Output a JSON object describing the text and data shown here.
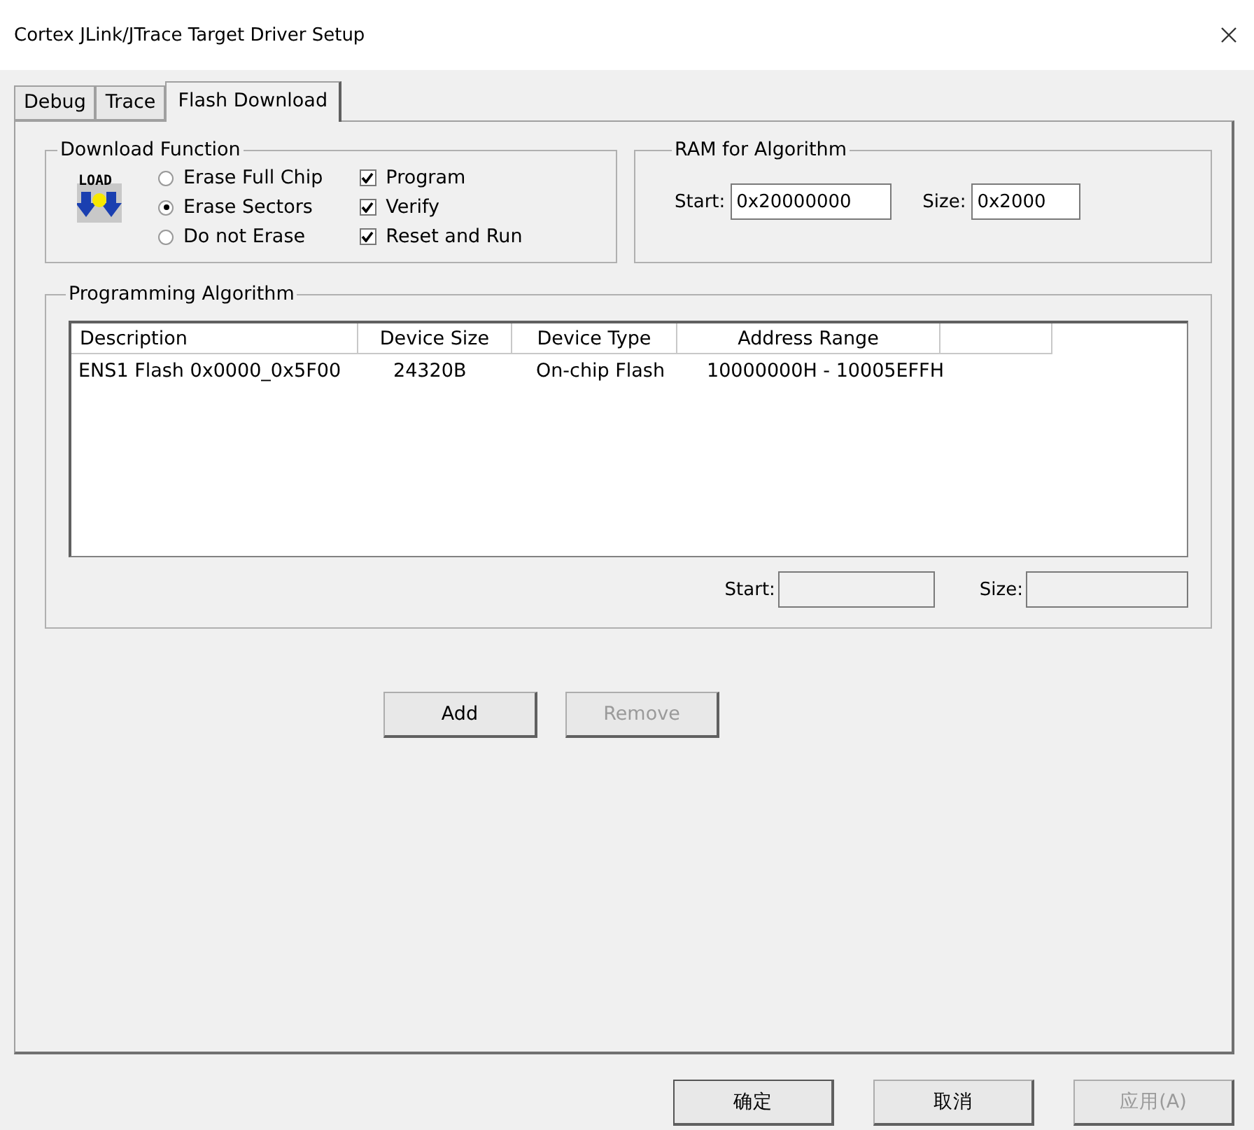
{
  "window": {
    "title": "Cortex JLink/JTrace Target Driver Setup"
  },
  "tabs": [
    {
      "label": "Debug",
      "selected": false
    },
    {
      "label": "Trace",
      "selected": false
    },
    {
      "label": "Flash Download",
      "selected": true
    }
  ],
  "download_function": {
    "title": "Download Function",
    "icon_label": "LOAD",
    "erase_options": [
      {
        "label": "Erase Full Chip",
        "selected": false
      },
      {
        "label": "Erase Sectors",
        "selected": true
      },
      {
        "label": "Do not Erase",
        "selected": false
      }
    ],
    "actions": [
      {
        "label": "Program",
        "checked": true
      },
      {
        "label": "Verify",
        "checked": true
      },
      {
        "label": "Reset and Run",
        "checked": true
      }
    ]
  },
  "ram_for_algorithm": {
    "title": "RAM for Algorithm",
    "start": {
      "label": "Start:",
      "value": "0x20000000"
    },
    "size": {
      "label": "Size:",
      "value": "0x2000"
    }
  },
  "programming_algorithm": {
    "title": "Programming Algorithm",
    "columns": [
      "Description",
      "Device Size",
      "Device Type",
      "Address Range"
    ],
    "rows": [
      {
        "cells": [
          "ENS1 Flash 0x0000_0x5F00",
          "24320B",
          "On-chip Flash",
          "10000000H - 10005EFFH"
        ],
        "selected": false
      }
    ],
    "start": {
      "label": "Start:",
      "disabled": true
    },
    "size": {
      "label": "Size:",
      "disabled": true
    }
  },
  "list_buttons": [
    {
      "label": "Add",
      "disabled": false
    },
    {
      "label": "Remove",
      "disabled": true
    }
  ],
  "dialog_buttons": [
    {
      "label": "确定",
      "disabled": false,
      "default": true
    },
    {
      "label": "取消",
      "disabled": false,
      "default": false
    },
    {
      "label": "应用(A)",
      "disabled": true,
      "default": false
    }
  ]
}
